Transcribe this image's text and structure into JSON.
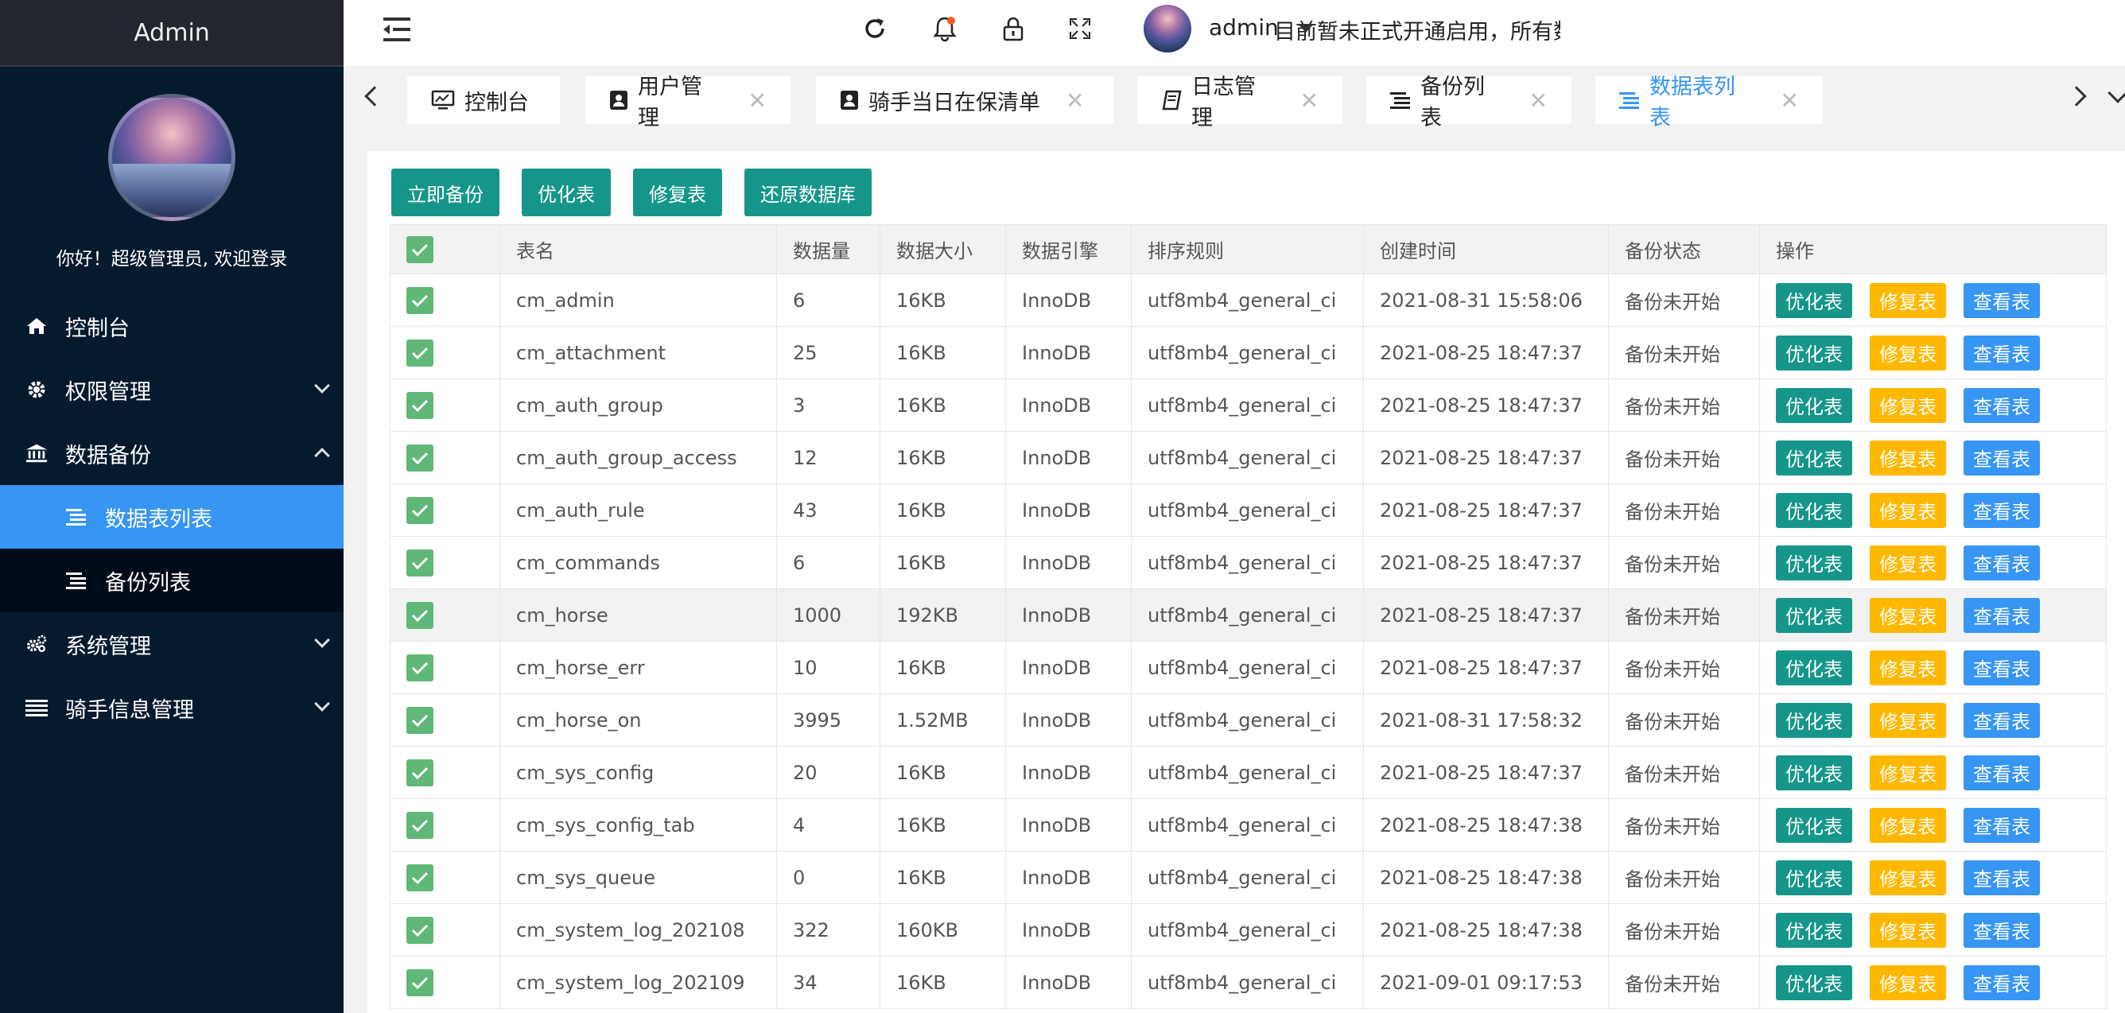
{
  "sidebar": {
    "brand": "Admin",
    "welcome": "你好！超级管理员, 欢迎登录",
    "items": [
      {
        "label": "控制台"
      },
      {
        "label": "权限管理"
      },
      {
        "label": "数据备份"
      },
      {
        "label": "数据表列表"
      },
      {
        "label": "备份列表"
      },
      {
        "label": "系统管理"
      },
      {
        "label": "骑手信息管理"
      }
    ]
  },
  "topbar": {
    "notice": "目前暂未正式开通启用，所有数据",
    "username": "admin"
  },
  "tabs": [
    {
      "label": "控制台"
    },
    {
      "label": "用户管理"
    },
    {
      "label": "骑手当日在保清单"
    },
    {
      "label": "日志管理"
    },
    {
      "label": "备份列表"
    },
    {
      "label": "数据表列表"
    }
  ],
  "toolbar": {
    "backup": "立即备份",
    "optimize": "优化表",
    "repair": "修复表",
    "restore": "还原数据库"
  },
  "table": {
    "columns": [
      "表名",
      "数据量",
      "数据大小",
      "数据引擎",
      "排序规则",
      "创建时间",
      "备份状态",
      "操作"
    ],
    "actions": {
      "optimize": "优化表",
      "repair": "修复表",
      "view": "查看表"
    },
    "rows": [
      {
        "name": "cm_admin",
        "count": "6",
        "size": "16KB",
        "engine": "InnoDB",
        "collation": "utf8mb4_general_ci",
        "created": "2021-08-31 15:58:06",
        "status": "备份未开始"
      },
      {
        "name": "cm_attachment",
        "count": "25",
        "size": "16KB",
        "engine": "InnoDB",
        "collation": "utf8mb4_general_ci",
        "created": "2021-08-25 18:47:37",
        "status": "备份未开始"
      },
      {
        "name": "cm_auth_group",
        "count": "3",
        "size": "16KB",
        "engine": "InnoDB",
        "collation": "utf8mb4_general_ci",
        "created": "2021-08-25 18:47:37",
        "status": "备份未开始"
      },
      {
        "name": "cm_auth_group_access",
        "count": "12",
        "size": "16KB",
        "engine": "InnoDB",
        "collation": "utf8mb4_general_ci",
        "created": "2021-08-25 18:47:37",
        "status": "备份未开始"
      },
      {
        "name": "cm_auth_rule",
        "count": "43",
        "size": "16KB",
        "engine": "InnoDB",
        "collation": "utf8mb4_general_ci",
        "created": "2021-08-25 18:47:37",
        "status": "备份未开始"
      },
      {
        "name": "cm_commands",
        "count": "6",
        "size": "16KB",
        "engine": "InnoDB",
        "collation": "utf8mb4_general_ci",
        "created": "2021-08-25 18:47:37",
        "status": "备份未开始"
      },
      {
        "name": "cm_horse",
        "count": "1000",
        "size": "192KB",
        "engine": "InnoDB",
        "collation": "utf8mb4_general_ci",
        "created": "2021-08-25 18:47:37",
        "status": "备份未开始"
      },
      {
        "name": "cm_horse_err",
        "count": "10",
        "size": "16KB",
        "engine": "InnoDB",
        "collation": "utf8mb4_general_ci",
        "created": "2021-08-25 18:47:37",
        "status": "备份未开始"
      },
      {
        "name": "cm_horse_on",
        "count": "3995",
        "size": "1.52MB",
        "engine": "InnoDB",
        "collation": "utf8mb4_general_ci",
        "created": "2021-08-31 17:58:32",
        "status": "备份未开始"
      },
      {
        "name": "cm_sys_config",
        "count": "20",
        "size": "16KB",
        "engine": "InnoDB",
        "collation": "utf8mb4_general_ci",
        "created": "2021-08-25 18:47:37",
        "status": "备份未开始"
      },
      {
        "name": "cm_sys_config_tab",
        "count": "4",
        "size": "16KB",
        "engine": "InnoDB",
        "collation": "utf8mb4_general_ci",
        "created": "2021-08-25 18:47:38",
        "status": "备份未开始"
      },
      {
        "name": "cm_sys_queue",
        "count": "0",
        "size": "16KB",
        "engine": "InnoDB",
        "collation": "utf8mb4_general_ci",
        "created": "2021-08-25 18:47:38",
        "status": "备份未开始"
      },
      {
        "name": "cm_system_log_202108",
        "count": "322",
        "size": "160KB",
        "engine": "InnoDB",
        "collation": "utf8mb4_general_ci",
        "created": "2021-08-25 18:47:38",
        "status": "备份未开始"
      },
      {
        "name": "cm_system_log_202109",
        "count": "34",
        "size": "16KB",
        "engine": "InnoDB",
        "collation": "utf8mb4_general_ci",
        "created": "2021-09-01 09:17:53",
        "status": "备份未开始"
      }
    ]
  },
  "colors": {
    "sidebar_bg": "#061a2e",
    "active": "#3795f3",
    "green": "#16968a",
    "orange": "#ffb800",
    "checkbox": "#5fb878"
  }
}
